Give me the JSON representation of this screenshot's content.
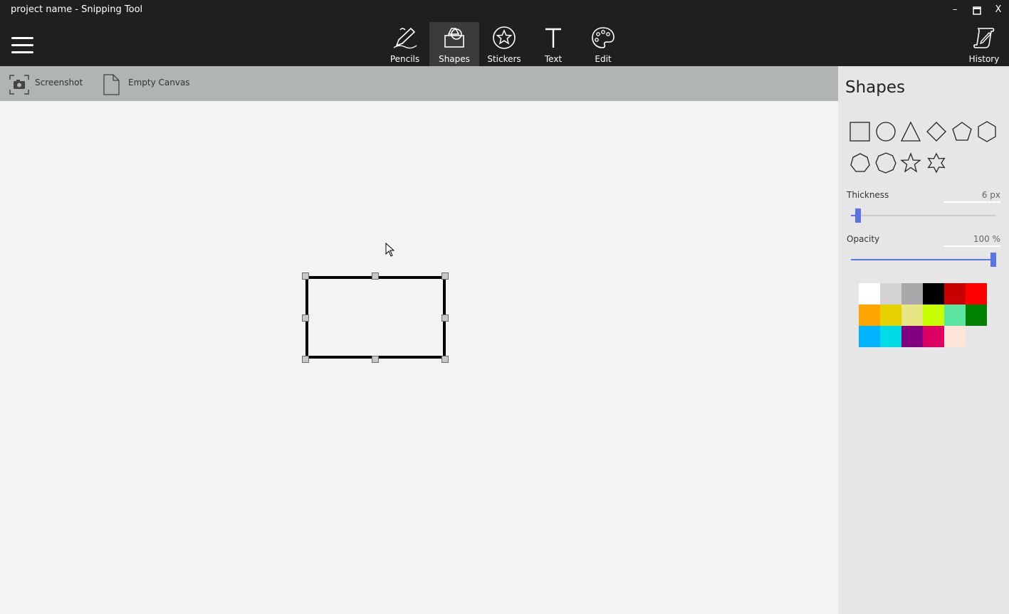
{
  "window": {
    "title": "project name - Snipping Tool",
    "minimize": "–",
    "maximize": "☐",
    "close": "X"
  },
  "toolbar": {
    "menu_icon": "hamburger-icon",
    "tools": [
      {
        "label": "Pencils",
        "icon": "pencil-icon",
        "active": false
      },
      {
        "label": "Shapes",
        "icon": "shapes-icon",
        "active": true
      },
      {
        "label": "Stickers",
        "icon": "sticker-icon",
        "active": false
      },
      {
        "label": "Text",
        "icon": "text-icon",
        "active": false
      },
      {
        "label": "Edit",
        "icon": "palette-icon",
        "active": false
      }
    ],
    "history_label": "History"
  },
  "subbar": {
    "screenshot_label": "Screenshot",
    "empty_canvas_label": "Empty Canvas"
  },
  "panel": {
    "title": "Shapes",
    "shapes": [
      "rectangle",
      "circle",
      "triangle",
      "diamond",
      "pentagon",
      "hexagon",
      "heptagon",
      "octagon",
      "star-5",
      "star-6"
    ],
    "thickness": {
      "label": "Thickness",
      "value": "6 px",
      "fraction": 0.03
    },
    "opacity": {
      "label": "Opacity",
      "value": "100 %",
      "fraction": 1.0
    },
    "colors": [
      "#ffffff",
      "#d3d3d3",
      "#a9a9a9",
      "#000000",
      "#c80000",
      "#ff0000",
      "#ffa500",
      "#e6d200",
      "#e6e682",
      "#c8ff00",
      "#5ae6a0",
      "#008000",
      "#00b4ff",
      "#00dce6",
      "#800080",
      "#dc0064",
      "#ffe4d8"
    ],
    "accent": "#5a73e6"
  }
}
